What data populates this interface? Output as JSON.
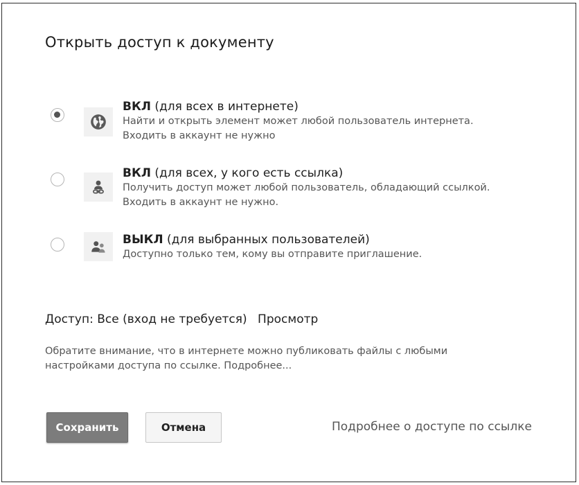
{
  "dialog": {
    "title": "Открыть доступ к документу"
  },
  "options": [
    {
      "icon": "globe-icon",
      "title_strong": "ВКЛ",
      "title_rest": " (для всех в интернете)",
      "desc_line1": "Найти и открыть элемент может любой пользователь интернета.",
      "desc_line2": "Входить в аккаунт не нужно",
      "selected": true
    },
    {
      "icon": "person-link-icon",
      "title_strong": "ВКЛ",
      "title_rest": " (для всех, у кого есть ссылка)",
      "desc_line1": "Получить доступ может любой пользователь, обладающий ссылкой.",
      "desc_line2": "Входить в аккаунт не нужно.",
      "selected": false
    },
    {
      "icon": "people-icon",
      "title_strong": "ВЫКЛ",
      "title_rest": " (для выбранных пользователей)",
      "desc_line1": "Доступно только тем, кому вы отправите приглашение.",
      "desc_line2": "",
      "selected": false
    }
  ],
  "access": {
    "label": "Доступ:",
    "value": "Все (вход не требуется)",
    "mode": "Просмотр"
  },
  "note": {
    "line1": "Обратите внимание, что в интернете можно публиковать файлы с любыми",
    "line2": "настройками доступа по ссылке. Подробнее..."
  },
  "buttons": {
    "save": "Сохранить",
    "cancel": "Отмена"
  },
  "footer_link": "Подробнее о доступе по ссылке",
  "colors": {
    "save_bg": "#7c7c7c",
    "radio_selected": "#555555",
    "text_secondary": "#555555"
  }
}
